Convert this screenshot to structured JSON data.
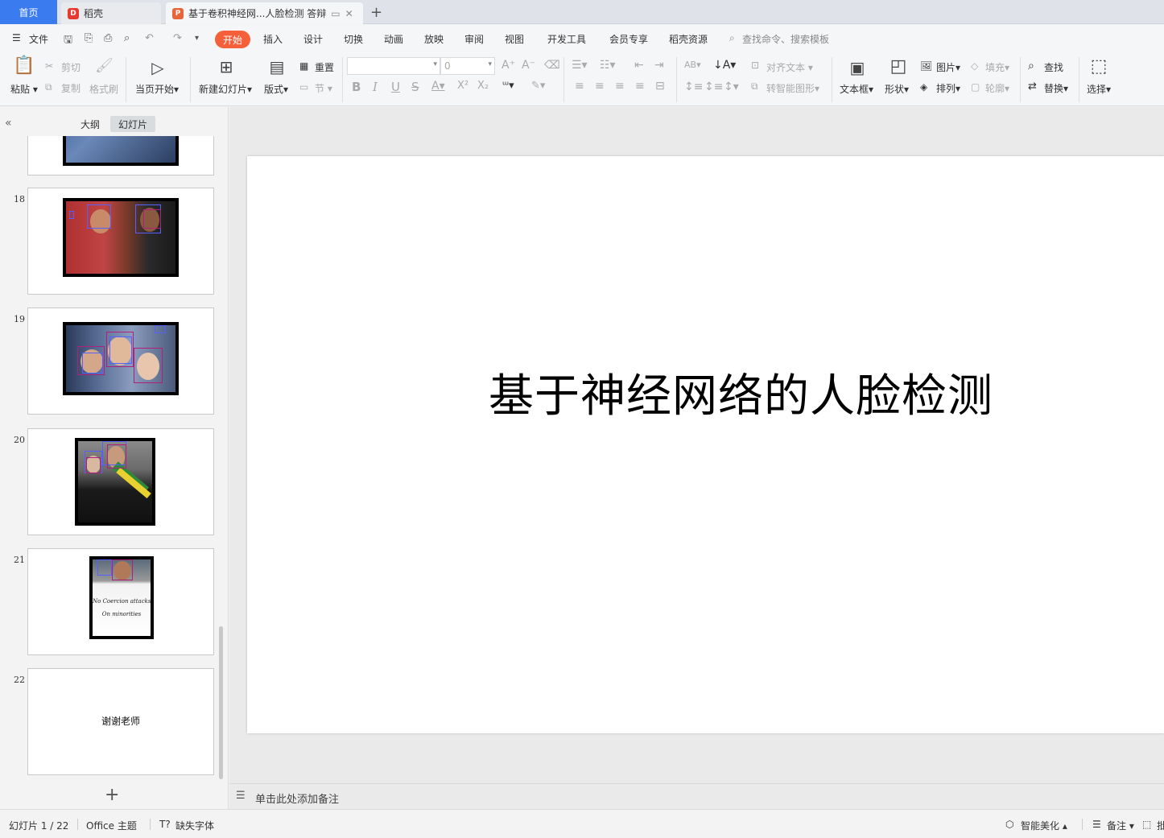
{
  "tabs": {
    "home": "首页",
    "daoke": "稻壳",
    "document": "基于卷积神经网...人脸检测 答辩",
    "add": "+"
  },
  "menu": {
    "file": "文件",
    "items": [
      "开始",
      "插入",
      "设计",
      "切换",
      "动画",
      "放映",
      "审阅",
      "视图",
      "开发工具",
      "会员专享",
      "稻壳资源"
    ],
    "search_placeholder": "查找命令、搜索模板"
  },
  "ribbon": {
    "paste": "粘贴",
    "cut": "剪切",
    "copy": "复制",
    "format_painter": "格式刷",
    "from_current": "当页开始",
    "new_slide": "新建幻灯片",
    "layout": "版式",
    "reset": "重置",
    "section": "节",
    "font_size": "0",
    "align_text": "对齐文本",
    "smart_art": "转智能图形",
    "text_box": "文本框",
    "shape": "形状",
    "picture": "图片",
    "arrange": "排列",
    "fill": "填充",
    "outline": "轮廓",
    "find": "查找",
    "replace": "替换",
    "select": "选择"
  },
  "panel": {
    "outline_tab": "大纲",
    "slides_tab": "幻灯片",
    "thumbnails": [
      {
        "num": "18"
      },
      {
        "num": "19"
      },
      {
        "num": "20"
      },
      {
        "num": "21",
        "photo_text_1": "No Coercion attacks",
        "photo_text_2": "On minorities"
      },
      {
        "num": "22",
        "text": "谢谢老师"
      }
    ]
  },
  "slide": {
    "title": "基于神经网络的人脸检测"
  },
  "notes": {
    "placeholder": "单击此处添加备注"
  },
  "status": {
    "slide_counter": "幻灯片 1 / 22",
    "theme": "Office 主题",
    "missing_font": "缺失字体",
    "smart_beautify": "智能美化",
    "notes": "备注",
    "comment": "批"
  },
  "colors": {
    "accent": "#3a7bf0",
    "active_menu": "#f5603a",
    "face_box_blue": "#5560ff",
    "face_box_magenta": "#b0207a"
  }
}
